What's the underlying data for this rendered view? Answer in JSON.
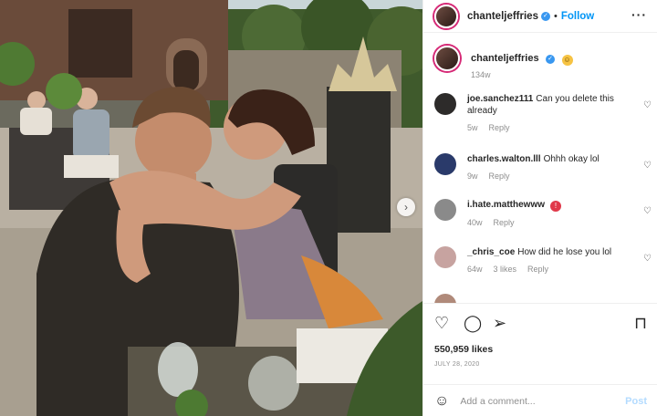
{
  "header": {
    "username": "chanteljeffries",
    "follow_label": "Follow",
    "more_icon": "more-horizontal-icon"
  },
  "caption": {
    "username": "chanteljeffries",
    "time": "134w"
  },
  "comments": [
    {
      "user": "joe.sanchez111",
      "text": "Can you delete this already",
      "time": "5w",
      "reply": "Reply",
      "likes": ""
    },
    {
      "user": "charles.walton.lll",
      "text": "Ohhh okay lol",
      "time": "9w",
      "reply": "Reply",
      "likes": ""
    },
    {
      "user": "i.hate.matthewww",
      "text": "",
      "time": "40w",
      "reply": "Reply",
      "likes": ""
    },
    {
      "user": "_chris_coe",
      "text": "How did he lose you lol",
      "time": "64w",
      "reply": "Reply",
      "likes": "3 likes"
    }
  ],
  "actions": {
    "likes": "550,959 likes",
    "date": "JULY 28, 2020"
  },
  "add_comment": {
    "placeholder": "Add a comment...",
    "post_label": "Post"
  },
  "colors": {
    "accent": "#0095f6",
    "post_disabled": "#b3dbff",
    "verified": "#3897f0"
  }
}
